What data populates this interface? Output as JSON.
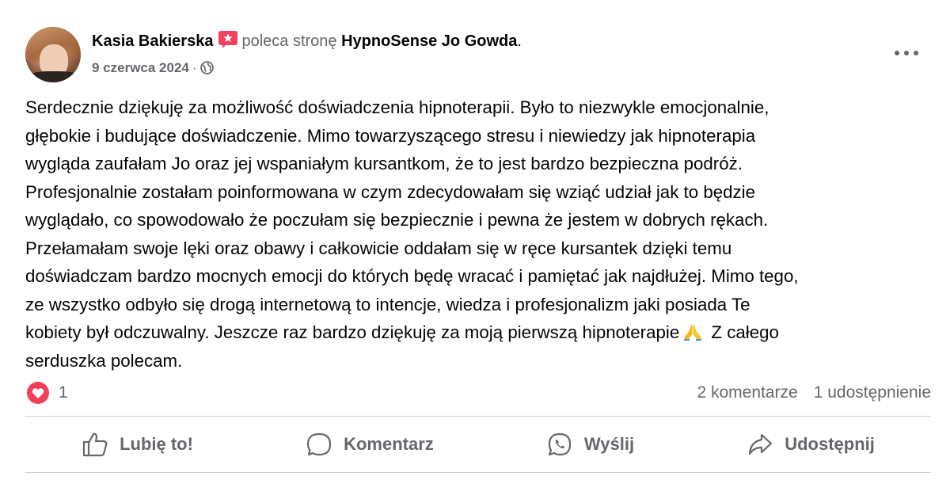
{
  "post": {
    "author": "Kasia Bakierska",
    "recommends_text": "poleca stronę",
    "page_name": "HypnoSense Jo Gowda",
    "page_suffix": ".",
    "date": "9 czerwca 2024",
    "meta_separator": "·",
    "icons": {
      "recommend": "recommend-icon",
      "privacy": "globe-icon",
      "more": "more-options-icon",
      "pray": "folded-hands-emoji"
    },
    "body_before_emoji": "Serdecznie dziękuję za możliwość doświadczenia hipnoterapii. Było to niezwykle emocjonalnie,\ngłębokie i budujące doświadczenie. Mimo towarzyszącego stresu i niewiedzy jak hipnoterapia\nwygląda zaufałam Jo oraz jej wspaniałym kursantkom, że to jest bardzo bezpieczna podróż.\nProfesjonalnie zostałam poinformowana w czym zdecydowałam się wziąć udział jak to będzie\nwyglądało, co spowodowało że poczułam się bezpiecznie i pewna że jestem w dobrych rękach.\nPrzełamałam swoje lęki oraz obawy i całkowicie oddałam się w ręce kursantek dzięki temu\ndoświadczam bardzo mocnych emocji do których będę wracać i pamiętać jak najdłużej. Mimo tego,\nze wszystko odbyło się drogą internetową to intencje, wiedza i profesjonalizm jaki posiada Te\nkobiety był odczuwalny. Jeszcze raz bardzo dziękuję za moją pierwszą hipnoterapie",
    "body_after_emoji": " Z całego\nserduszka polecam."
  },
  "stats": {
    "reaction_count": "1",
    "reaction_icon": "heart-reaction-icon",
    "comments": "2 komentarze",
    "shares": "1 udostępnienie"
  },
  "actions": {
    "like": "Lubię to!",
    "comment": "Komentarz",
    "send": "Wyślij",
    "share": "Udostępnij"
  },
  "colors": {
    "text_primary": "#050505",
    "text_secondary": "#65676b",
    "heart": "#f33e58",
    "recommend_badge": "#f3425f",
    "divider": "#ced0d4"
  }
}
